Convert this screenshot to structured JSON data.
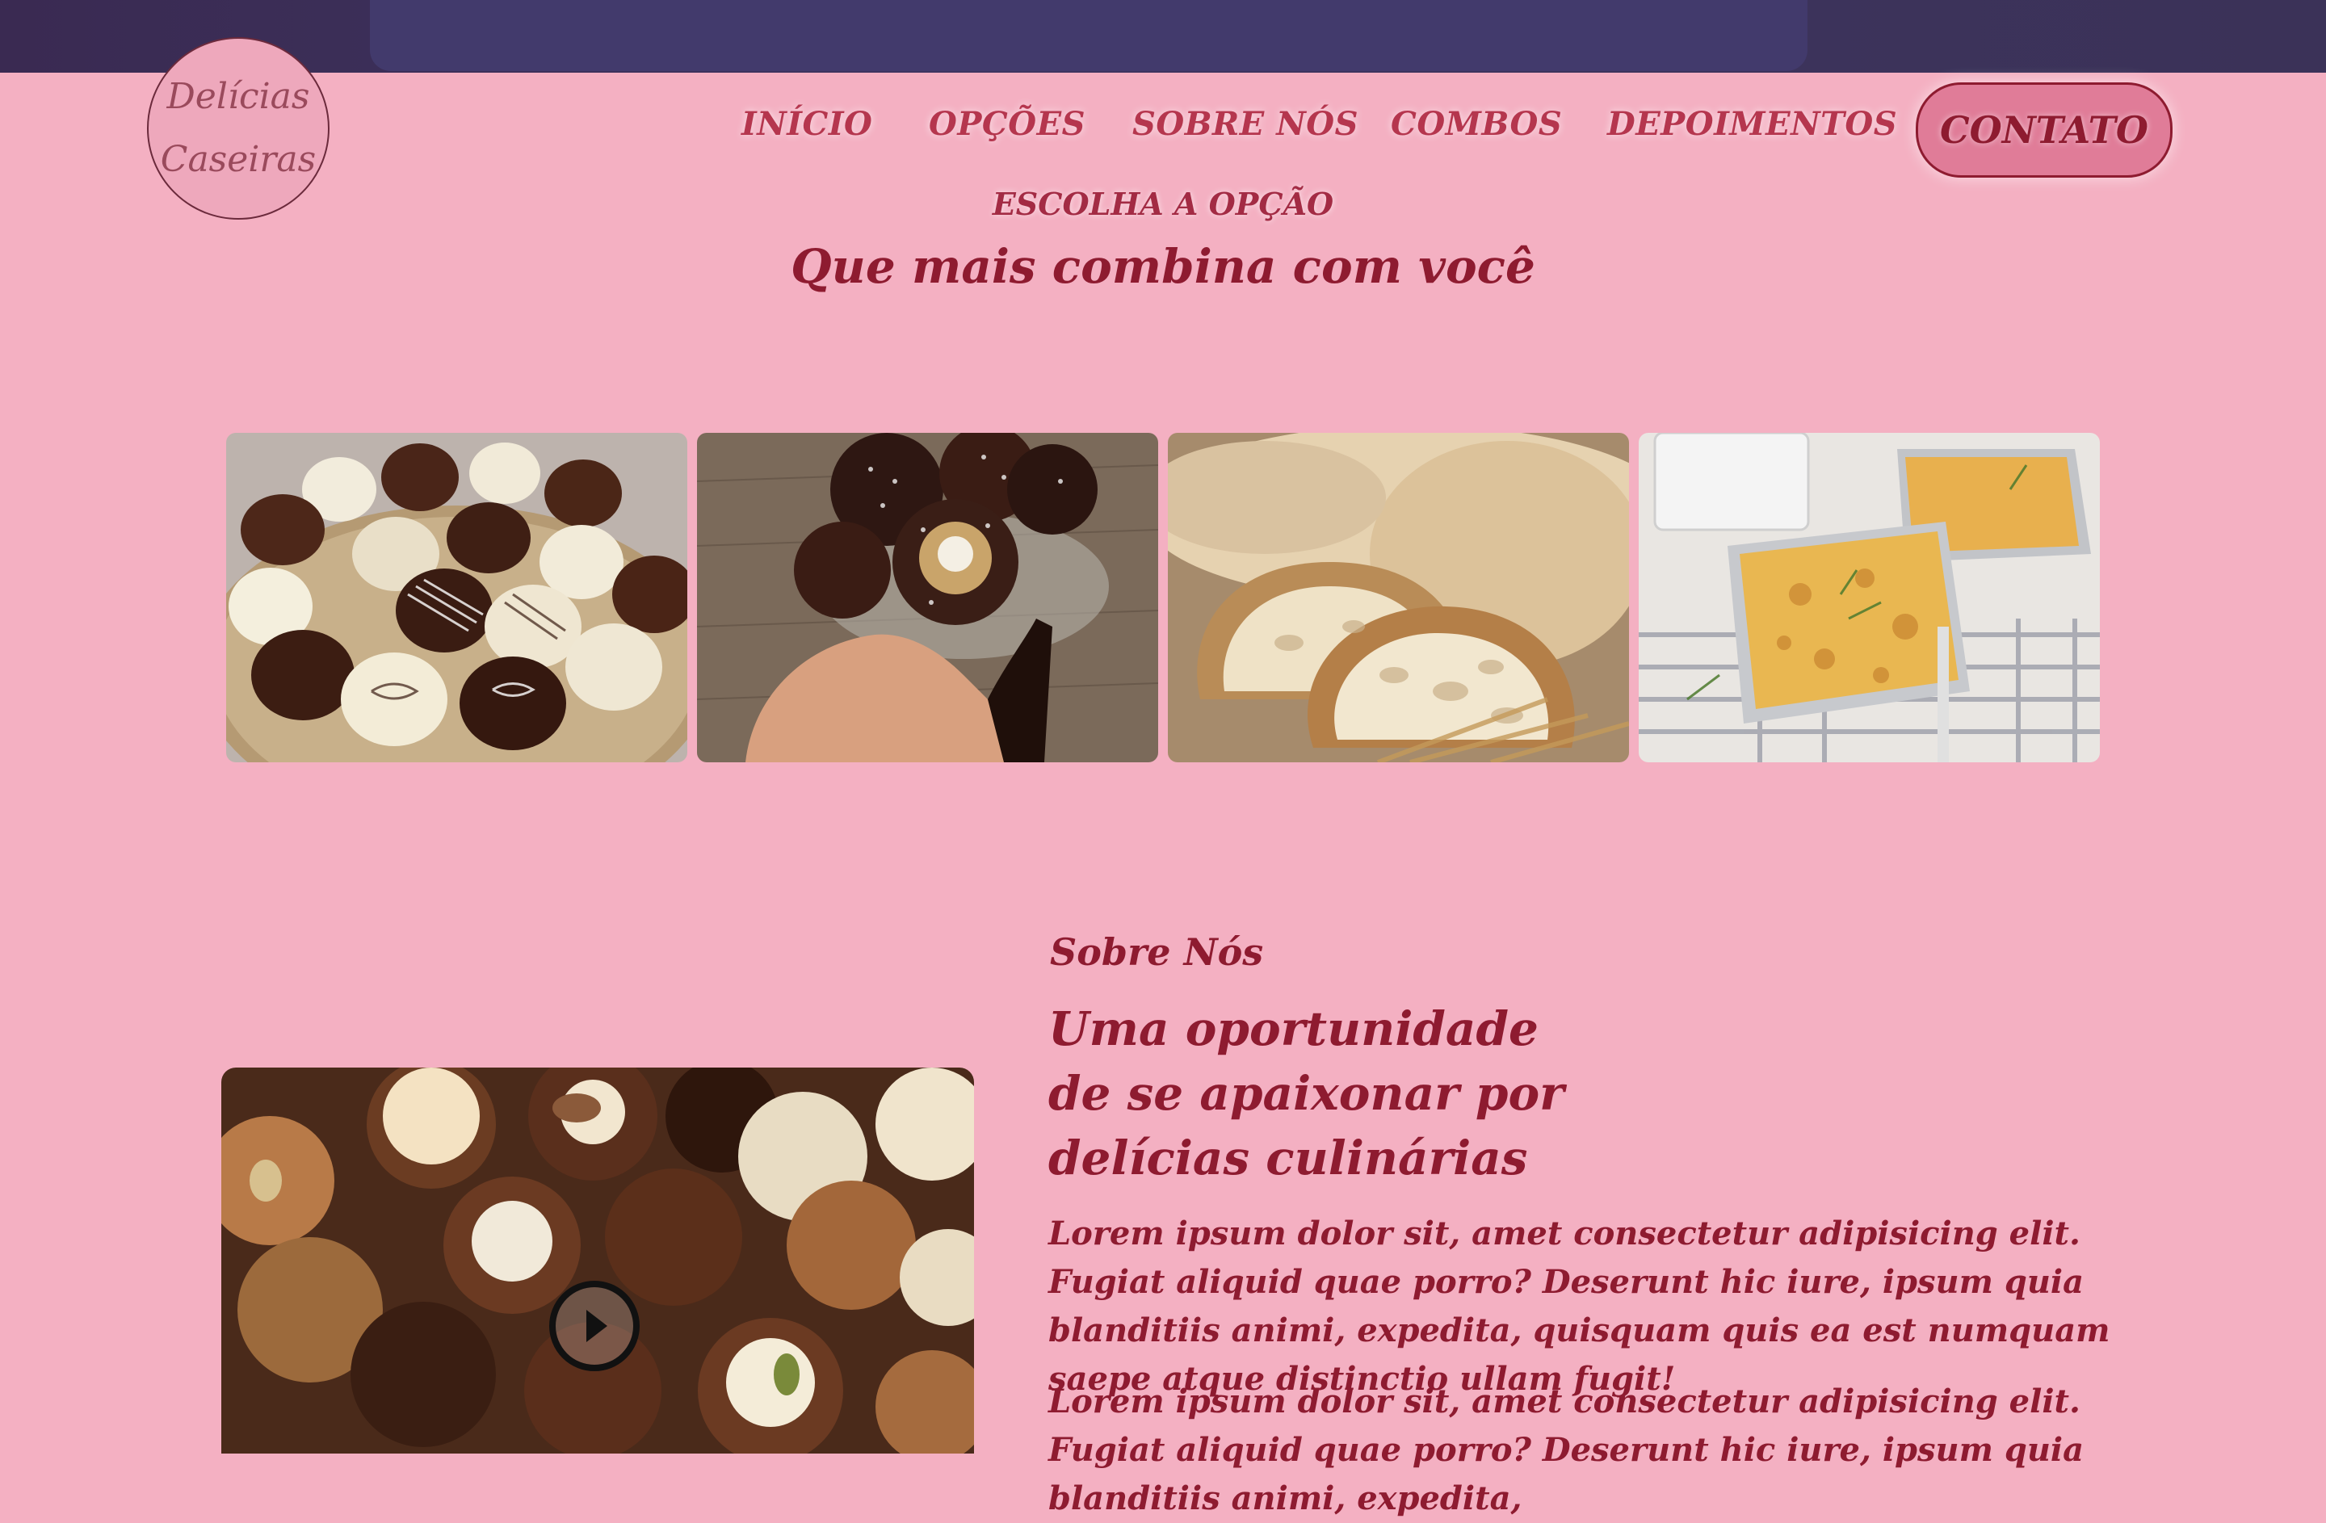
{
  "brand": {
    "line1": "Delícias",
    "line2": "Caseiras"
  },
  "nav": {
    "items": [
      {
        "label": "INÍCIO"
      },
      {
        "label": "OPÇÕES"
      },
      {
        "label": "SOBRE NÓS"
      },
      {
        "label": "COMBOS"
      },
      {
        "label": "DEPOIMENTOS"
      }
    ],
    "cta": "CONTATO"
  },
  "options": {
    "eyebrow": "ESCOLHA A OPÇÃO",
    "title": "Que mais combina com você",
    "cards": [
      {
        "icon": "bonbons-image"
      },
      {
        "icon": "coconut-truffle-image"
      },
      {
        "icon": "bread-image"
      },
      {
        "icon": "baked-pasta-image"
      }
    ]
  },
  "about": {
    "label": "Sobre Nós",
    "title": "Uma oportunidade de se apaixonar por delícias culinárias",
    "paragraphs": [
      "Lorem ipsum dolor sit, amet consectetur adipisicing elit. Fugiat aliquid quae porro? Deserunt hic iure, ipsum quia blanditiis animi, expedita, quisquam quis ea est numquam saepe atque distinctio ullam fugit!",
      "Lorem ipsum dolor sit, amet consectetur adipisicing elit. Fugiat aliquid quae porro? Deserunt hic iure, ipsum quia blanditiis animi, expedita,"
    ]
  },
  "colors": {
    "background": "#f4b0c2",
    "accent": "#8e1b30",
    "header": "#3d3560"
  }
}
